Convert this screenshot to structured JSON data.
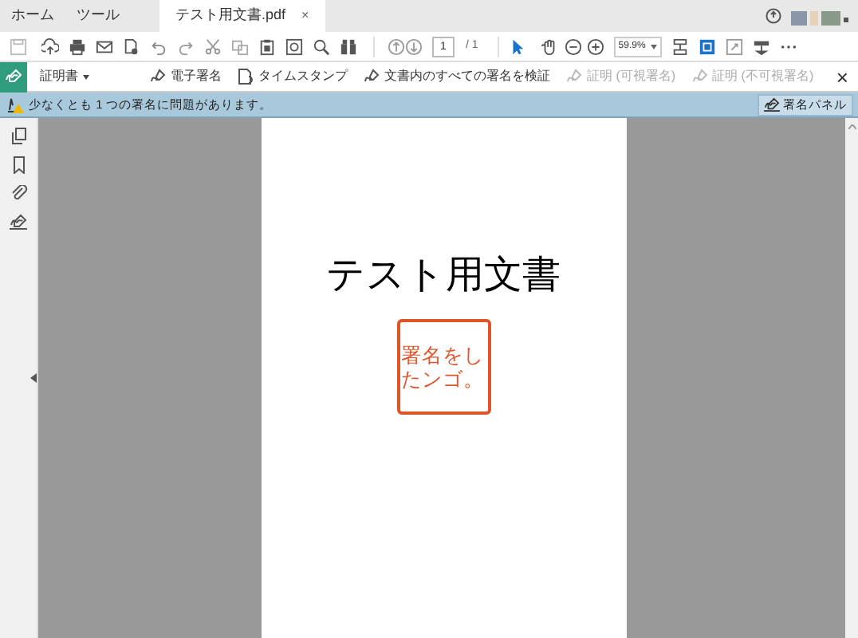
{
  "tabs": [
    {
      "label": "ホーム",
      "selected": false
    },
    {
      "label": "ツール",
      "selected": false
    },
    {
      "label": "テスト用文書.pdf",
      "selected": true,
      "close": "×"
    }
  ],
  "toolbar": {
    "page": "1",
    "page_total": "/ 1",
    "zoom": "59.9%"
  },
  "signature_bar": {
    "menu": "証明書",
    "items": [
      {
        "label": "電子署名",
        "disabled": false
      },
      {
        "label": "タイムスタンプ",
        "disabled": false
      },
      {
        "label": "文書内のすべての署名を検証",
        "disabled": false
      },
      {
        "label": "証明 (可視署名)",
        "disabled": true
      },
      {
        "label": "証明 (不可視署名)",
        "disabled": true
      }
    ],
    "close": "×"
  },
  "warning": {
    "message": "少なくとも 1 つの署名に問題があります。",
    "button": "署名パネル"
  },
  "document": {
    "title": "テスト用文書",
    "stamp": "署名をしたンゴ。"
  }
}
